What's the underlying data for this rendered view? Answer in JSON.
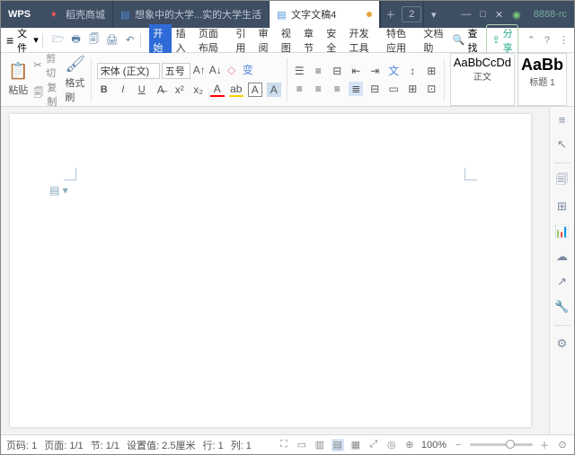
{
  "titlebar": {
    "app": "WPS",
    "tabs": [
      {
        "label": "稻壳商城",
        "icon_color": "#e55"
      },
      {
        "label": "想象中的大学...实的大学生活",
        "icon_color": "#4a90d9"
      },
      {
        "label": "文字文稿4",
        "icon_color": "#4a90d9",
        "active": true,
        "unsaved": true
      }
    ],
    "window_count": "2",
    "sys": {
      "min": "—",
      "max": "□",
      "close": "✕"
    },
    "server": "8888-rc"
  },
  "menubar": {
    "file": "文件",
    "tabs": [
      "开始",
      "插入",
      "页面布局",
      "引用",
      "审阅",
      "视图",
      "章节",
      "安全",
      "开发工具",
      "特色应用",
      "文档助"
    ],
    "search": "查找",
    "share": "分享"
  },
  "ribbon": {
    "clipboard": {
      "paste": "粘贴",
      "cut": "剪切",
      "copy": "复制",
      "brush": "格式刷"
    },
    "font": {
      "name": "宋体 (正文)",
      "size": "五号"
    },
    "styles": {
      "normal_prev": "AaBbCcDd",
      "normal_lbl": "正文",
      "h1_prev": "AaBb",
      "h1_lbl": "标题 1"
    }
  },
  "statusbar": {
    "page": "页码: 1",
    "pages": "页面: 1/1",
    "section": "节: 1/1",
    "setval": "设置值: 2.5厘米",
    "row": "行: 1",
    "col": "列: 1",
    "zoom": "100%"
  }
}
